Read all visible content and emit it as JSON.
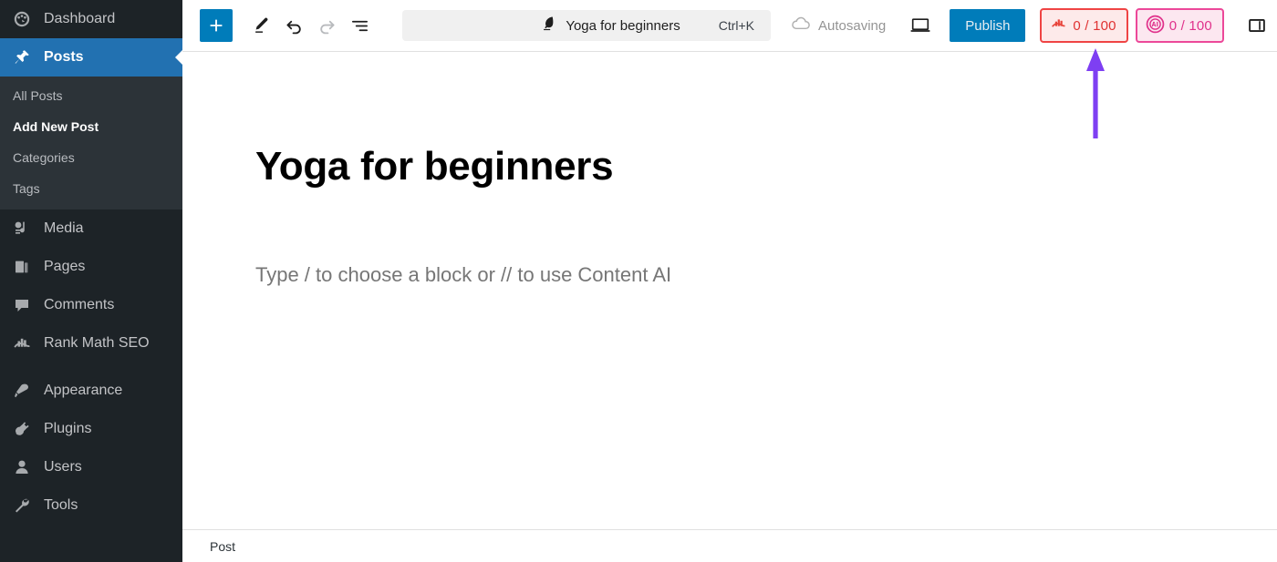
{
  "sidebar": {
    "items": [
      {
        "label": "Dashboard",
        "icon": "dashboard-icon",
        "name": "dashboard",
        "active": false
      },
      {
        "label": "Posts",
        "icon": "pin-icon",
        "name": "posts",
        "active": true
      },
      {
        "label": "Media",
        "icon": "media-icon",
        "name": "media",
        "active": false
      },
      {
        "label": "Pages",
        "icon": "pages-icon",
        "name": "pages",
        "active": false
      },
      {
        "label": "Comments",
        "icon": "comments-icon",
        "name": "comments",
        "active": false
      },
      {
        "label": "Rank Math SEO",
        "icon": "rank-math-icon",
        "name": "rank-math-seo",
        "active": false
      },
      {
        "label": "Appearance",
        "icon": "appearance-icon",
        "name": "appearance",
        "active": false
      },
      {
        "label": "Plugins",
        "icon": "plugins-icon",
        "name": "plugins",
        "active": false
      },
      {
        "label": "Users",
        "icon": "users-icon",
        "name": "users",
        "active": false
      },
      {
        "label": "Tools",
        "icon": "tools-icon",
        "name": "tools",
        "active": false
      }
    ],
    "submenu": {
      "parent": "Posts",
      "items": [
        {
          "label": "All Posts",
          "current": false
        },
        {
          "label": "Add New Post",
          "current": true
        },
        {
          "label": "Categories",
          "current": false
        },
        {
          "label": "Tags",
          "current": false
        }
      ]
    }
  },
  "header": {
    "add_block_label": "+",
    "add_block_icon": "plus-icon",
    "tools_icon": "pencil-icon",
    "undo_icon": "undo-icon",
    "redo_icon": "redo-icon",
    "overview_icon": "document-overview-icon",
    "command_bar": {
      "icon": "quill-icon",
      "title": "Yoga for beginners",
      "shortcut": "Ctrl+K"
    },
    "autosave": {
      "icon": "cloud-icon",
      "label": "Autosaving"
    },
    "preview_icon": "desktop-preview-icon",
    "publish_label": "Publish",
    "seo_score": {
      "icon": "rank-math-icon",
      "value": "0 / 100",
      "border_color": "#ef4444",
      "text_color": "#e03232",
      "background_color": "#fdeaea"
    },
    "ai_score": {
      "icon": "content-ai-icon",
      "value": "0 / 100",
      "border_color": "#ec4899",
      "text_color": "#e0318b",
      "background_color": "#fce7f0"
    },
    "settings_sidebar_icon": "sidebar-toggle-icon",
    "options_icon": "ellipsis-vertical-icon"
  },
  "canvas": {
    "post_title": "Yoga for beginners",
    "block_placeholder": "Type / to choose a block or // to use Content AI"
  },
  "footer": {
    "breadcrumb": "Post"
  },
  "annotation": {
    "arrow_color": "#7e3ff2",
    "points_to": "seo-score-badge"
  },
  "colors": {
    "sidebar_bg": "#1d2327",
    "submenu_bg": "#2c3338",
    "active_blue": "#2271b1",
    "accent_blue": "#007cba"
  }
}
